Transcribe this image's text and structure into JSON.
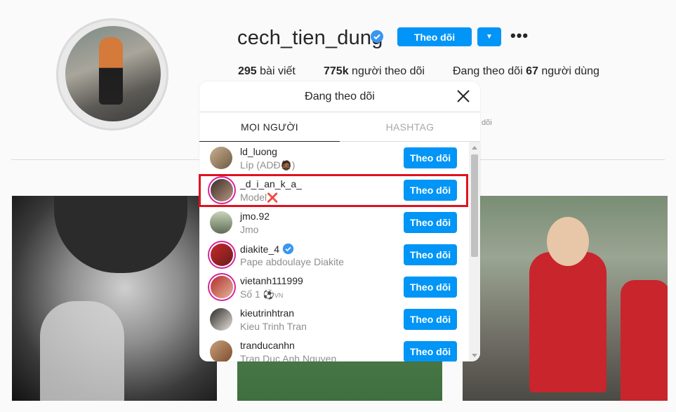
{
  "profile": {
    "username": "cech_tien_dung",
    "follow_label": "Theo dõi",
    "more_label": "•••",
    "posts_count": "295",
    "posts_label": " bài viết",
    "followers_count": "775k",
    "followers_label": " người theo dõi",
    "following_prefix": "Đang theo dõi ",
    "following_count": "67",
    "following_suffix": " người dùng",
    "faint_text": "dõi"
  },
  "modal": {
    "title": "Đang theo dõi",
    "tabs": [
      {
        "label": "MỌI NGƯỜI",
        "active": true
      },
      {
        "label": "HASHTAG",
        "active": false
      }
    ],
    "rows": [
      {
        "username": "ld_luong",
        "fullname": "Líp (ADĐ",
        "fullname_suffix": "🧔🏾",
        "fullname_end": ")",
        "verified": false,
        "button": "Theo dõi"
      },
      {
        "username": "_d_i_an_k_a_",
        "fullname": "Model",
        "fullname_suffix": "❌",
        "fullname_end": "",
        "verified": false,
        "button": "Theo dõi"
      },
      {
        "username": "jmo.92",
        "fullname": "Jmo",
        "fullname_suffix": "",
        "fullname_end": "",
        "verified": false,
        "button": "Theo dõi"
      },
      {
        "username": "diakite_4",
        "fullname": "Pape abdoulaye Diakite",
        "fullname_suffix": "",
        "fullname_end": "",
        "verified": true,
        "button": "Theo dõi"
      },
      {
        "username": "vietanh111999",
        "fullname": "Số 1 ",
        "fullname_suffix": "⚽",
        "fullname_end": "VN",
        "verified": false,
        "button": "Theo dõi"
      },
      {
        "username": "kieutrinhtran",
        "fullname": "Kieu Trinh Tran",
        "fullname_suffix": "",
        "fullname_end": "",
        "verified": false,
        "button": "Theo dõi"
      },
      {
        "username": "tranducanhn",
        "fullname": "Tran Duc Anh Nguyen",
        "fullname_suffix": "",
        "fullname_end": "",
        "verified": false,
        "button": "Theo dõi"
      }
    ]
  },
  "colors": {
    "accent": "#0095f6",
    "highlight": "#e0121e",
    "verified": "#3897f0"
  }
}
